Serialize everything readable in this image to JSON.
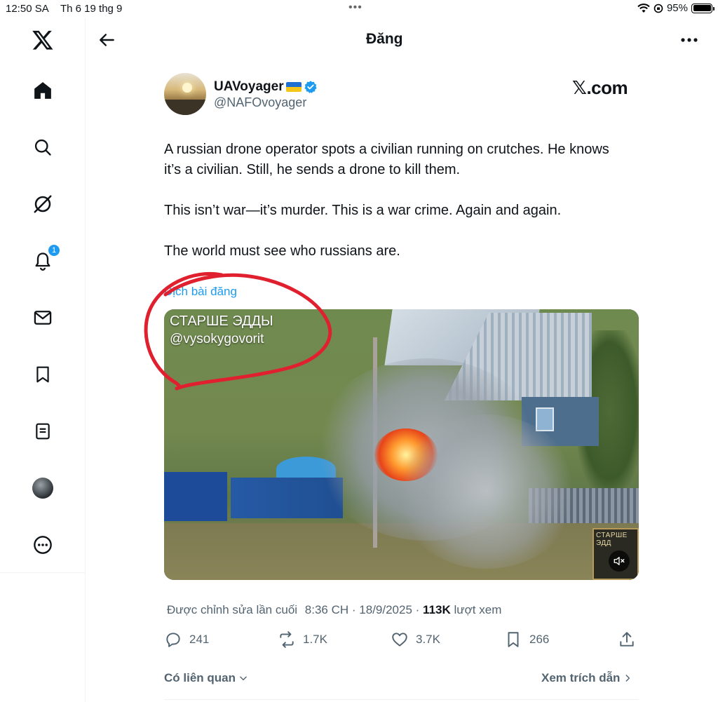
{
  "status_bar": {
    "time": "12:50 SA",
    "date": "Th 6 19 thg 9",
    "dots": "•••",
    "battery": "95%"
  },
  "sidebar": {
    "items": [
      {
        "name": "x-logo-icon"
      },
      {
        "name": "home-icon"
      },
      {
        "name": "search-icon"
      },
      {
        "name": "grok-icon"
      },
      {
        "name": "bell-icon",
        "badge": "1"
      },
      {
        "name": "mail-icon"
      },
      {
        "name": "bookmark-icon"
      },
      {
        "name": "lists-icon"
      },
      {
        "name": "profile-avatar"
      },
      {
        "name": "more-circle-icon"
      }
    ]
  },
  "header": {
    "title": "Đăng"
  },
  "tweet": {
    "author_name": "UAVoyager",
    "author_handle": "@NAFOvoyager",
    "watermark": "𝕏.com",
    "paragraphs": [
      "A russian drone operator spots a civilian running on crutches. He knows it’s a civilian. Still, he sends a drone to kill them.",
      "This isn’t war—it’s murder. This is a war crime. Again and again.",
      "The world must see who russians are."
    ],
    "translate_label": "Dịch bài đăng",
    "media": {
      "overlay_title": "СТАРШЕ ЭДДЫ",
      "overlay_handle": "@vysokygovorit",
      "corner_logo_text": "СТАРШЕ ЭДД"
    },
    "meta": {
      "edited_label": "Được chỉnh sửa lần cuối",
      "time": "8:36 CH",
      "date": "18/9/2025",
      "views_count": "113K",
      "views_label": "lượt xem"
    },
    "actions": {
      "replies": "241",
      "reposts": "1.7K",
      "likes": "3.7K",
      "bookmarks": "266"
    },
    "related_label": "Có liên quan",
    "quotes_label": "Xem trích dẫn"
  },
  "colors": {
    "accent": "#1d9bf0",
    "text": "#0f1419",
    "muted": "#536471",
    "annotation": "#e0202e"
  }
}
